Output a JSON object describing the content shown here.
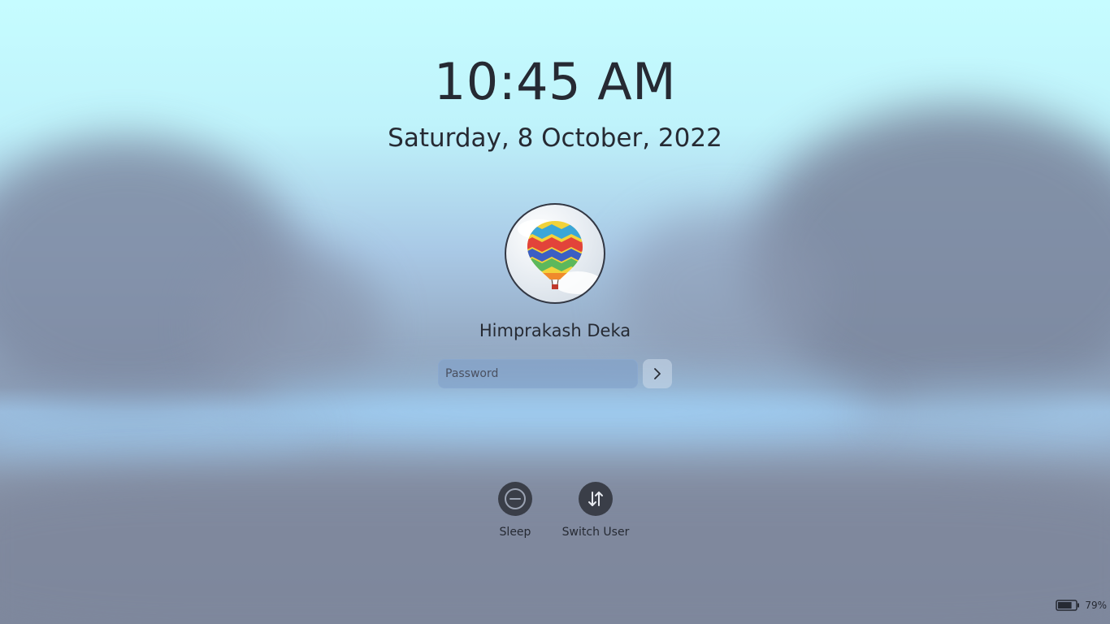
{
  "lockscreen": {
    "time": "10:45 AM",
    "date": "Saturday, 8 October, 2022",
    "user": {
      "name": "Himprakash Deka",
      "avatar_icon": "hot-air-balloon-icon"
    },
    "password": {
      "placeholder": "Password",
      "value": ""
    },
    "actions": [
      {
        "label": "Sleep",
        "icon": "sleep-icon"
      },
      {
        "label": "Switch User",
        "icon": "switch-user-icon"
      }
    ],
    "battery": {
      "percent_label": "79%",
      "level": 0.79
    }
  }
}
